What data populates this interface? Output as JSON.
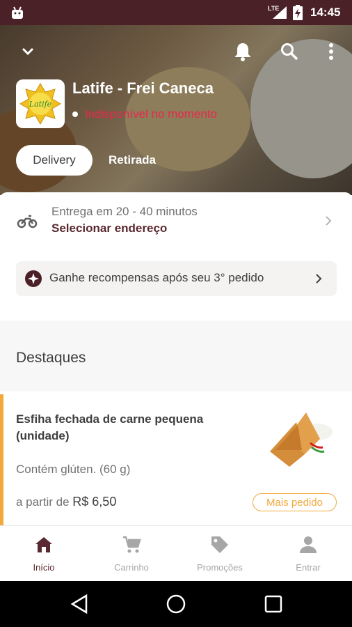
{
  "status_bar": {
    "network": "LTE",
    "time": "14:45"
  },
  "store": {
    "name": "Latife - Frei Caneca",
    "status": "Indisponível no momento",
    "logo_text": "Latife"
  },
  "tabs": {
    "delivery": "Delivery",
    "pickup": "Retirada"
  },
  "delivery_info": {
    "time_text": "Entrega em 20 - 40 minutos",
    "address_action": "Selecionar endereço"
  },
  "rewards": {
    "text": "Ganhe recompensas após seu 3° pedido"
  },
  "highlights": {
    "title": "Destaques",
    "items": [
      {
        "name": "Esfiha fechada de carne pequena (unidade)",
        "description": "Contém glúten. (60 g)",
        "price_prefix": "a partir de",
        "price": "R$ 6,50",
        "badge": "Mais pedido"
      }
    ]
  },
  "bottom_nav": {
    "items": [
      {
        "label": "Início",
        "icon": "home-icon"
      },
      {
        "label": "Carrinho",
        "icon": "cart-icon"
      },
      {
        "label": "Promoções",
        "icon": "tag-icon"
      },
      {
        "label": "Entrar",
        "icon": "person-icon"
      }
    ]
  },
  "colors": {
    "brand": "#5a2830",
    "status_bar": "#4a2127",
    "accent": "#f2a93b",
    "unavailable": "#e8294b"
  }
}
